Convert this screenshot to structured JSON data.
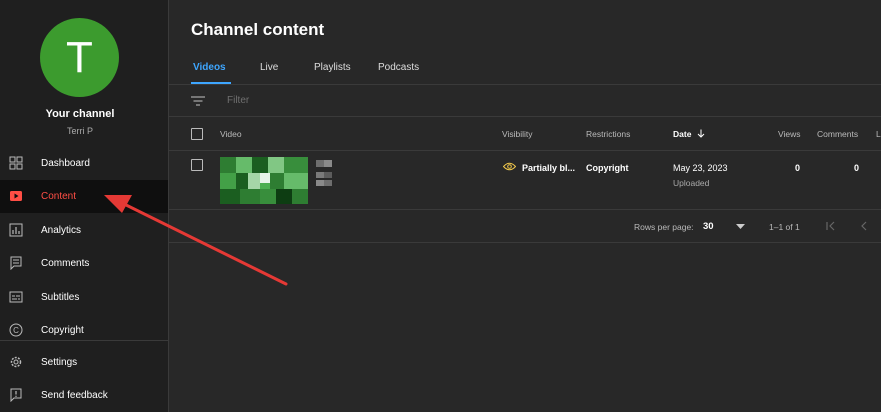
{
  "sidebar": {
    "avatar_letter": "T",
    "avatar_color": "#3c9b2e",
    "channel_title": "Your channel",
    "channel_user": "Terri P",
    "items": [
      {
        "label": "Dashboard",
        "icon": "dashboard-icon"
      },
      {
        "label": "Content",
        "icon": "content-icon",
        "active": true
      },
      {
        "label": "Analytics",
        "icon": "analytics-icon"
      },
      {
        "label": "Comments",
        "icon": "comments-icon"
      },
      {
        "label": "Subtitles",
        "icon": "subtitles-icon"
      },
      {
        "label": "Copyright",
        "icon": "copyright-icon"
      },
      {
        "label": "Settings",
        "icon": "gear-icon"
      },
      {
        "label": "Send feedback",
        "icon": "feedback-icon"
      }
    ]
  },
  "main": {
    "title": "Channel content",
    "tabs": [
      {
        "label": "Videos",
        "active": true
      },
      {
        "label": "Live"
      },
      {
        "label": "Playlists"
      },
      {
        "label": "Podcasts"
      }
    ],
    "filter_placeholder": "Filter",
    "table": {
      "headers": {
        "video": "Video",
        "visibility": "Visibility",
        "restrictions": "Restrictions",
        "date": "Date",
        "views": "Views",
        "comments": "Comments",
        "likes_partial": "L"
      },
      "rows": [
        {
          "visibility": "Partially bl...",
          "restrictions": "Copyright",
          "date": "May 23, 2023",
          "date_status": "Uploaded",
          "views": "0",
          "comments": "0"
        }
      ]
    },
    "pagination": {
      "rows_per_page_label": "Rows per page:",
      "rows_per_page_value": "30",
      "range": "1–1 of 1"
    }
  },
  "colors": {
    "accent_blue": "#3ea6ff",
    "active_red": "#ff4e45",
    "warning_yellow": "#f2c94c",
    "arrow_red": "#e53935"
  }
}
